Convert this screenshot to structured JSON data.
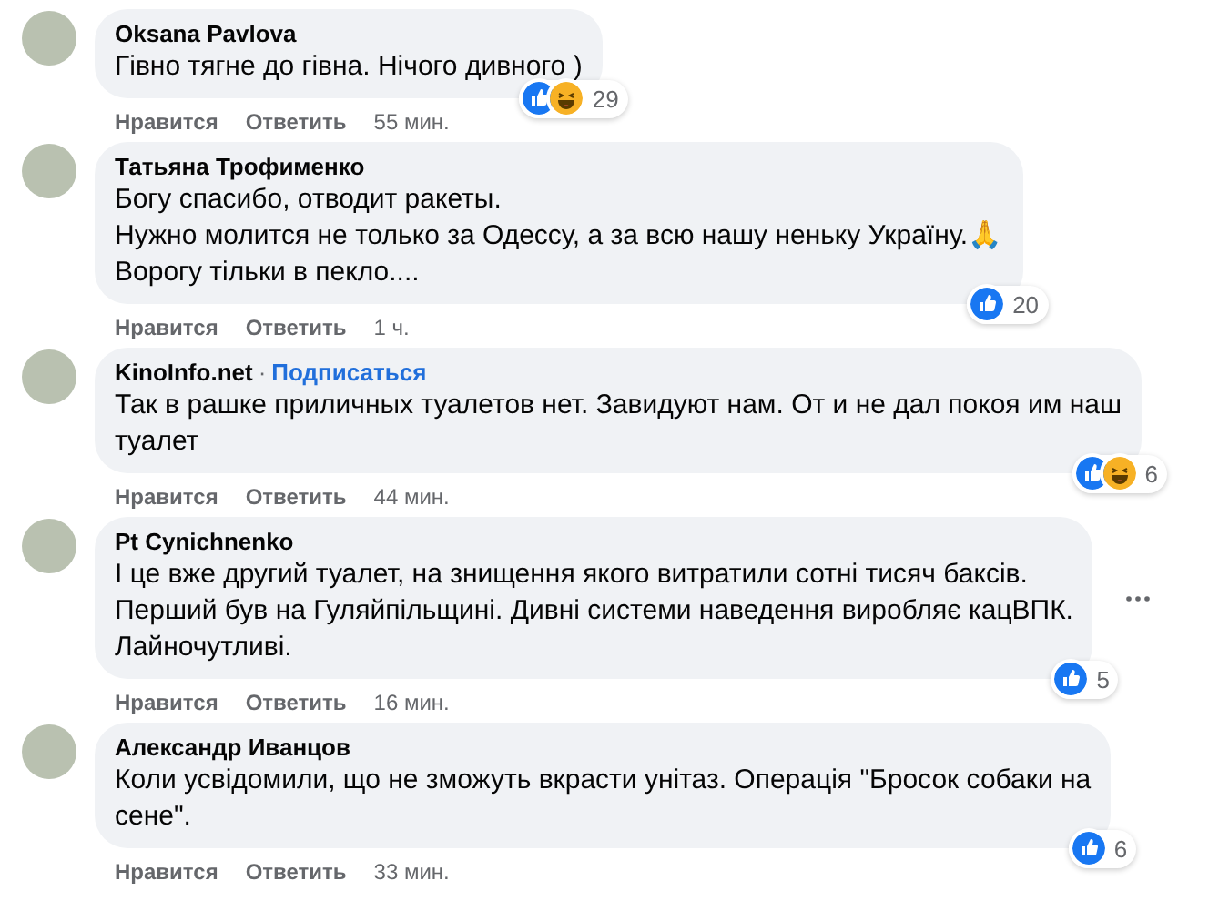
{
  "comments": [
    {
      "author": "Oksana Pavlova",
      "text": "Гівно тягне до гівна. Нічого дивного )",
      "reactions": [
        {
          "kind": "like"
        },
        {
          "kind": "haha"
        }
      ],
      "reaction_count": "29",
      "actions": [
        "Нравится",
        "Ответить"
      ],
      "time": "55 мин.",
      "more_menu": false
    },
    {
      "author": "Татьяна Трофименко",
      "text": "Богу спасибо, отводит ракеты.\nНужно молится не только за Одессу, а за всю нашу неньку Україну.🙏\nВорогу тільки в пекло....",
      "reactions": [
        {
          "kind": "like"
        }
      ],
      "reaction_count": "20",
      "actions": [
        "Нравится",
        "Ответить"
      ],
      "time": "1 ч.",
      "more_menu": false
    },
    {
      "author": "KinoInfo.net",
      "separator": "·",
      "follow": "Подписаться",
      "text": "Так в рашке приличных туалетов нет. Завидуют нам. От и не дал покоя им наш\nтуалет",
      "reactions": [
        {
          "kind": "like"
        },
        {
          "kind": "haha"
        }
      ],
      "reaction_count": "6",
      "actions": [
        "Нравится",
        "Ответить"
      ],
      "time": "44 мин.",
      "more_menu": false
    },
    {
      "author": "Pt Cynichnenko",
      "text": "І це вже другий туалет, на знищення якого витратили сотні тисяч баксів.\nПерший був на Гуляйпільщині. Дивні системи наведення виробляє кацВПК.\nЛайночутливі.",
      "reactions": [
        {
          "kind": "like"
        }
      ],
      "reaction_count": "5",
      "actions": [
        "Нравится",
        "Ответить"
      ],
      "time": "16 мин.",
      "more_menu": true
    },
    {
      "author": "Александр Иванцов",
      "text": "Коли усвідомили, що не зможуть вкрасти унітаз. Операція \"Бросок собаки на\nсене\".",
      "reactions": [
        {
          "kind": "like"
        }
      ],
      "reaction_count": "6",
      "actions": [
        "Нравится",
        "Ответить"
      ],
      "time": "33 мин.",
      "more_menu": false
    }
  ]
}
